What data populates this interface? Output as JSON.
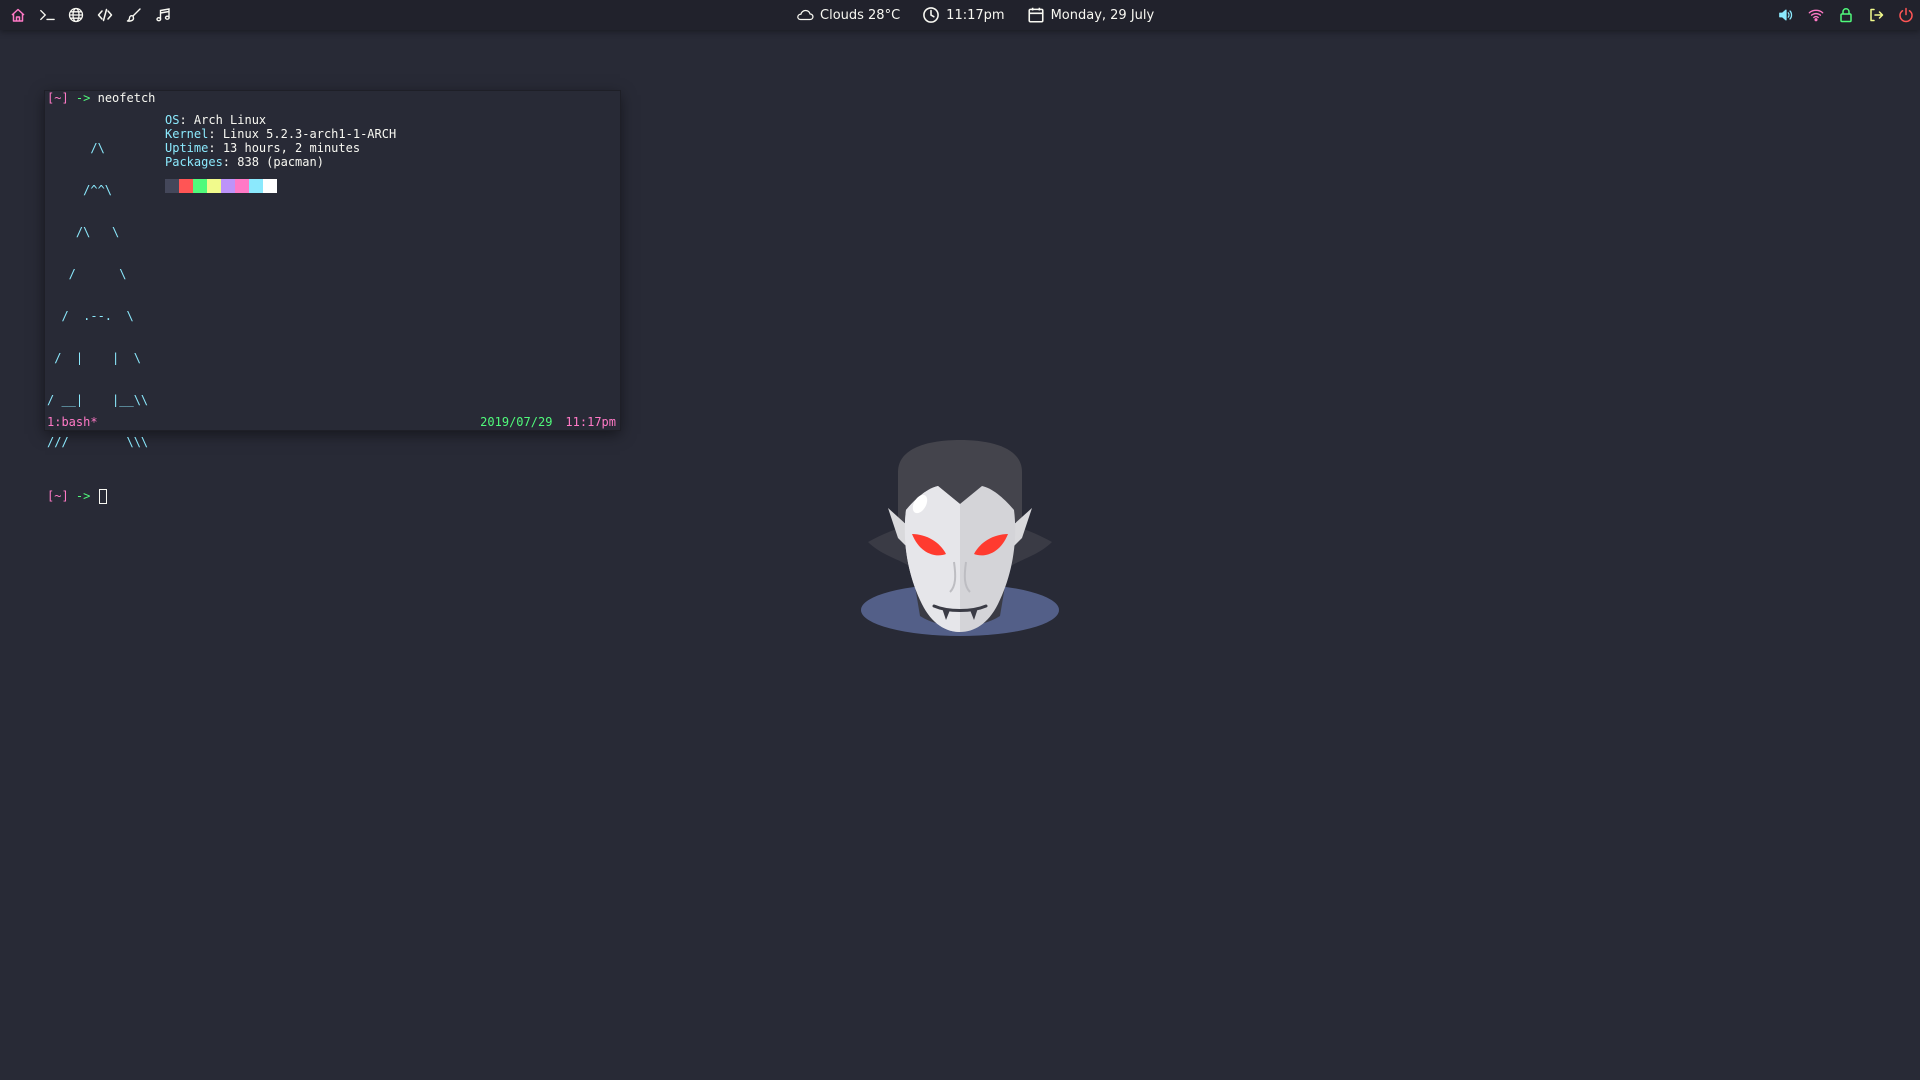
{
  "colors": {
    "background": "#282a36",
    "bar": "#21222c",
    "pink": "#ff79c6",
    "green": "#50fa7b",
    "cyan": "#8be9fd",
    "fg": "#f8f8f2"
  },
  "topbar": {
    "left_icons": [
      "home-icon",
      "terminal-icon",
      "globe-icon",
      "code-icon",
      "brush-icon",
      "music-icon"
    ],
    "weather": "Clouds 28°C",
    "time": "11:17pm",
    "date": "Monday, 29 July",
    "right_icons": [
      "volume-icon",
      "wifi-icon",
      "lock-icon",
      "logout-icon",
      "power-icon"
    ]
  },
  "terminal": {
    "prompt_bracket": "[~]",
    "prompt_arrow": "->",
    "command": "neofetch",
    "logo_lines": [
      "      /\\",
      "     /^^\\",
      "    /\\   \\",
      "   /      \\",
      "  /  .--.  \\",
      " /  |    |  \\",
      "/ __|    |__\\\\",
      "///        \\\\\\"
    ],
    "info": [
      {
        "key": "OS",
        "value": "Arch Linux"
      },
      {
        "key": "Kernel",
        "value": "Linux 5.2.3-arch1-1-ARCH"
      },
      {
        "key": "Uptime",
        "value": "13 hours, 2 minutes"
      },
      {
        "key": "Packages",
        "value": "838 (pacman)"
      }
    ],
    "swatch_colors": [
      "#44475a",
      "#ff5555",
      "#50fa7b",
      "#f1fa8c",
      "#bd93f9",
      "#ff79c6",
      "#8be9fd",
      "#ffffff"
    ],
    "status_left": "1:bash*",
    "status_date": "2019/07/29",
    "status_time": "11:17pm"
  }
}
